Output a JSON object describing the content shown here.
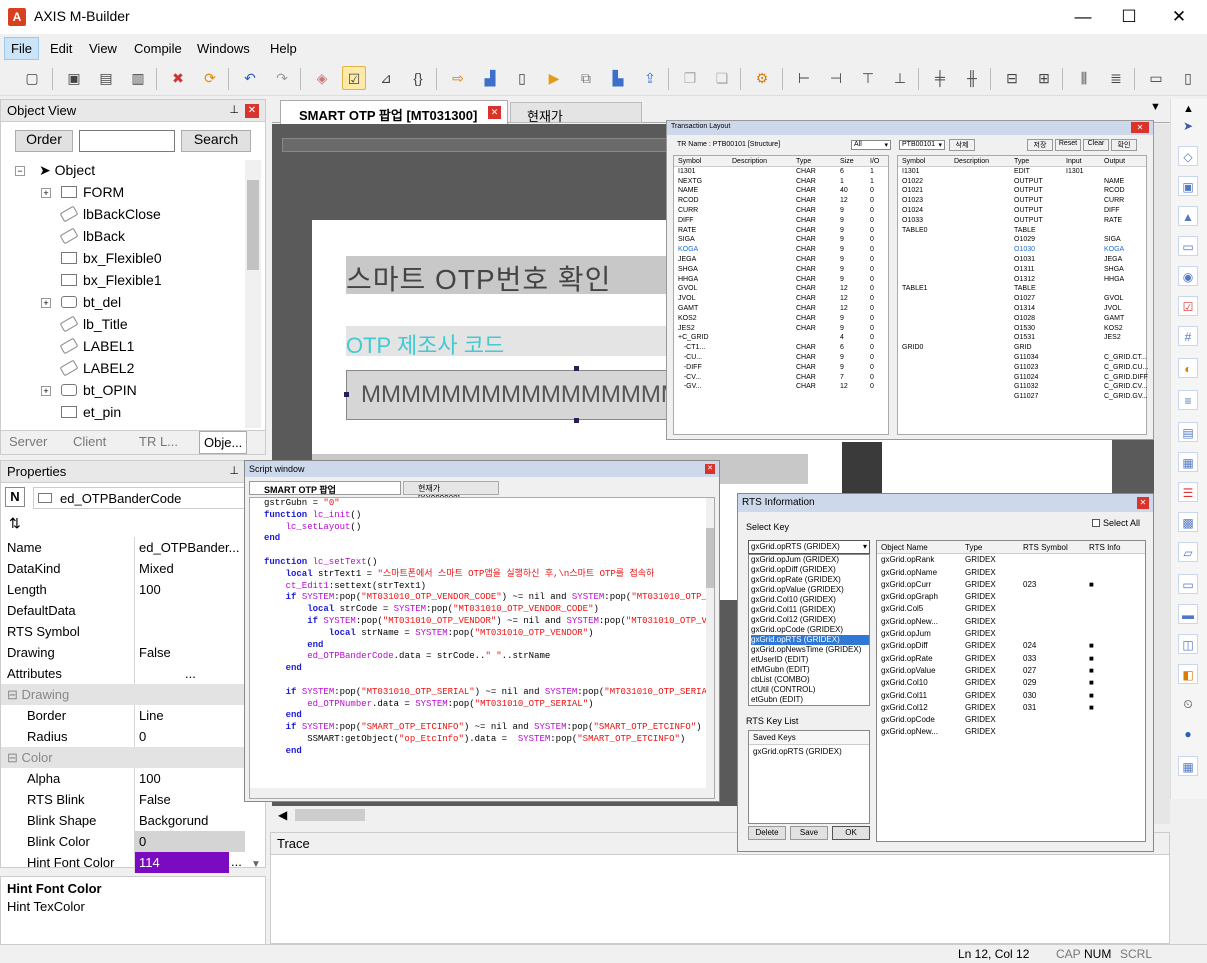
{
  "app": {
    "title": "AXIS M-Builder",
    "logo": "A",
    "min": "—",
    "max": "☐",
    "close": "✕"
  },
  "menu": [
    "File",
    "Edit",
    "View",
    "Compile",
    "Windows",
    "Help"
  ],
  "objectView": {
    "title": "Object View",
    "order": "Order",
    "search": "Search",
    "tree": [
      "Object",
      "FORM",
      "lbBackClose",
      "lbBack",
      "bx_Flexible0",
      "bx_Flexible1",
      "bt_del",
      "lb_Title",
      "LABEL1",
      "LABEL2",
      "bt_OPIN",
      "et_pin"
    ],
    "tabs": [
      "Server",
      "Client",
      "TR L...",
      "Obje..."
    ]
  },
  "properties": {
    "title": "Properties",
    "sortBtn": "N",
    "objectName": "ed_OTPBanderCode",
    "rows": [
      [
        "Name",
        "ed_OTPBander..."
      ],
      [
        "DataKind",
        "Mixed"
      ],
      [
        "Length",
        "100"
      ],
      [
        "DefaultData",
        ""
      ],
      [
        "RTS Symbol",
        ""
      ],
      [
        "Drawing",
        "False"
      ],
      [
        "Attributes",
        "..."
      ]
    ],
    "drawingCat": "Drawing",
    "drawingRows": [
      [
        "Border",
        "Line"
      ],
      [
        "Radius",
        "0"
      ]
    ],
    "colorCat": "Color",
    "colorRows": [
      [
        "Alpha",
        "100"
      ],
      [
        "RTS Blink",
        "False"
      ],
      [
        "Blink Shape",
        "Backgorund"
      ],
      [
        "Blink Color",
        "0"
      ],
      [
        "Hint Font Color",
        "114"
      ]
    ],
    "descTitle": "Hint Font Color",
    "descText": "Hint TexColor"
  },
  "docTabs": [
    "SMART OTP 팝업 [MT031300]",
    "현재가 [XX999900]"
  ],
  "canvas": {
    "title": "스마트 OTP번호 확인",
    "label": "OTP 제조사 코드",
    "field": "MMMMMMMMMMMMMMMMM"
  },
  "trLayout": {
    "title": "Transaction Layout",
    "trName": "TR Name :",
    "trCode": "PTB00101",
    "structure": "[Structure]",
    "all": "All",
    "combo2": "PTB00101",
    "del": "삭제",
    "save": "저장",
    "reset": "Reset",
    "clear": "Clear",
    "ok": "확인",
    "leftHdr": [
      "Symbol",
      "Description",
      "Type",
      "Size",
      "I/O"
    ],
    "left": [
      [
        "I1301",
        "",
        "CHAR",
        "6",
        "1"
      ],
      [
        "NEXTG",
        "",
        "CHAR",
        "1",
        "1"
      ],
      [
        "NAME",
        "",
        "CHAR",
        "40",
        "0"
      ],
      [
        "RCOD",
        "",
        "CHAR",
        "12",
        "0"
      ],
      [
        "CURR",
        "",
        "CHAR",
        "9",
        "0"
      ],
      [
        "DIFF",
        "",
        "CHAR",
        "9",
        "0"
      ],
      [
        "RATE",
        "",
        "CHAR",
        "9",
        "0"
      ],
      [
        "SIGA",
        "",
        "CHAR",
        "9",
        "0"
      ],
      [
        "KOGA",
        "",
        "CHAR",
        "9",
        "0"
      ],
      [
        "JEGA",
        "",
        "CHAR",
        "9",
        "0"
      ],
      [
        "SHGA",
        "",
        "CHAR",
        "9",
        "0"
      ],
      [
        "HHGA",
        "",
        "CHAR",
        "9",
        "0"
      ],
      [
        "GVOL",
        "",
        "CHAR",
        "12",
        "0"
      ],
      [
        "JVOL",
        "",
        "CHAR",
        "12",
        "0"
      ],
      [
        "GAMT",
        "",
        "CHAR",
        "12",
        "0"
      ],
      [
        "KOS2",
        "",
        "CHAR",
        "9",
        "0"
      ],
      [
        "JES2",
        "",
        "CHAR",
        "9",
        "0"
      ],
      [
        "+C_GRID",
        "",
        "",
        "4",
        "0"
      ],
      [
        "   -CT1...",
        "",
        "CHAR",
        "6",
        "0"
      ],
      [
        "   -CU...",
        "",
        "CHAR",
        "9",
        "0"
      ],
      [
        "   -DIFF",
        "",
        "CHAR",
        "9",
        "0"
      ],
      [
        "   -CV...",
        "",
        "CHAR",
        "7",
        "0"
      ],
      [
        "   -GV...",
        "",
        "CHAR",
        "12",
        "0"
      ]
    ],
    "rightHdr": [
      "Symbol",
      "Description",
      "Type",
      "Input",
      "Output"
    ],
    "right": [
      [
        "I1301",
        "",
        "EDIT",
        "I1301",
        ""
      ],
      [
        "O1022",
        "",
        "OUTPUT",
        "",
        "NAME"
      ],
      [
        "O1021",
        "",
        "OUTPUT",
        "",
        "RCOD"
      ],
      [
        "O1023",
        "",
        "OUTPUT",
        "",
        "CURR"
      ],
      [
        "O1024",
        "",
        "OUTPUT",
        "",
        "DIFF"
      ],
      [
        "O1033",
        "",
        "OUTPUT",
        "",
        "RATE"
      ],
      [
        "TABLE0",
        "",
        "TABLE",
        "",
        ""
      ],
      [
        "",
        "",
        "O1029",
        "",
        "SIGA"
      ],
      [
        "",
        "",
        "O1030",
        "",
        "KOGA"
      ],
      [
        "",
        "",
        "O1031",
        "",
        "JEGA"
      ],
      [
        "",
        "",
        "O1311",
        "",
        "SHGA"
      ],
      [
        "",
        "",
        "O1312",
        "",
        "HHGA"
      ],
      [
        "TABLE1",
        "",
        "TABLE",
        "",
        ""
      ],
      [
        "",
        "",
        "O1027",
        "",
        "GVOL"
      ],
      [
        "",
        "",
        "O1314",
        "",
        "JVOL"
      ],
      [
        "",
        "",
        "O1028",
        "",
        "GAMT"
      ],
      [
        "",
        "",
        "O1530",
        "",
        "KOS2"
      ],
      [
        "",
        "",
        "O1531",
        "",
        "JES2"
      ],
      [
        "GRID0",
        "",
        "GRID",
        "",
        ""
      ],
      [
        "",
        "",
        "G11034",
        "",
        "C_GRID.CT..."
      ],
      [
        "",
        "",
        "G11023",
        "",
        "C_GRID.CU..."
      ],
      [
        "",
        "",
        "G11024",
        "",
        "C_GRID.DIFF"
      ],
      [
        "",
        "",
        "G11032",
        "",
        "C_GRID.CV..."
      ],
      [
        "",
        "",
        "G11027",
        "",
        "C_GRID.GV..."
      ]
    ]
  },
  "script": {
    "title": "Script window",
    "tabs": [
      "SMART OTP 팝업 [MT031300]",
      "현재가 [XX999900]"
    ],
    "lines": [
      [
        [
          "gstrGubn = ",
          ""
        ],
        [
          "\"0\"",
          "str"
        ]
      ],
      [
        [
          "function ",
          "kw"
        ],
        [
          "lc_init",
          "fn"
        ],
        [
          "()",
          ""
        ]
      ],
      [
        [
          "    ",
          ""
        ],
        [
          "lc_setLayout",
          "fn"
        ],
        [
          "()",
          ""
        ]
      ],
      [
        [
          "end",
          "kw"
        ]
      ],
      [
        [
          "",
          ""
        ]
      ],
      [
        [
          "function ",
          "kw"
        ],
        [
          "lc_setText",
          "fn"
        ],
        [
          "()",
          ""
        ]
      ],
      [
        [
          "    local ",
          "kw"
        ],
        [
          "strText1 = ",
          ""
        ],
        [
          "\"스마트폰에서 스마트 OTP앱을 실행하신 후,\\n스마트 OTP를 접속하",
          ""
        ]
      ],
      [
        [
          "    ",
          ""
        ],
        [
          "ct_Edit1",
          "fn"
        ],
        [
          ":settext(strText1)",
          ""
        ]
      ],
      [
        [
          "    if ",
          "kw"
        ],
        [
          "SYSTEM",
          "fn"
        ],
        [
          ":pop(",
          ""
        ],
        [
          "\"MT031010_OTP_VENDOR_CODE\"",
          "str"
        ],
        [
          ") ~= nil and ",
          ""
        ],
        [
          "SYSTEM",
          "fn"
        ],
        [
          ":pop(",
          ""
        ],
        [
          "\"MT031010_OTP_",
          "str"
        ]
      ],
      [
        [
          "        local ",
          "kw"
        ],
        [
          "strCode = ",
          ""
        ],
        [
          "SYSTEM",
          "fn"
        ],
        [
          ":pop(",
          ""
        ],
        [
          "\"MT031010_OTP_VENDOR_CODE\"",
          "str"
        ],
        [
          ")",
          ""
        ]
      ],
      [
        [
          "        if ",
          "kw"
        ],
        [
          "SYSTEM",
          "fn"
        ],
        [
          ":pop(",
          ""
        ],
        [
          "\"MT031010_OTP_VENDOR\"",
          "str"
        ],
        [
          ") ~= nil and ",
          ""
        ],
        [
          "SYSTEM",
          "fn"
        ],
        [
          ":pop(",
          ""
        ],
        [
          "\"MT031010_OTP_V",
          "str"
        ]
      ],
      [
        [
          "            local ",
          "kw"
        ],
        [
          "strName = ",
          ""
        ],
        [
          "SYSTEM",
          "fn"
        ],
        [
          ":pop(",
          ""
        ],
        [
          "\"MT031010_OTP_VENDOR\"",
          "str"
        ],
        [
          ")",
          ""
        ]
      ],
      [
        [
          "        end",
          "kw"
        ]
      ],
      [
        [
          "        ",
          ""
        ],
        [
          "ed_OTPBanderCode",
          "fn"
        ],
        [
          ".data = strCode..",
          ""
        ],
        [
          "\" \"",
          "str"
        ],
        [
          "..strName",
          ""
        ]
      ],
      [
        [
          "    end",
          "kw"
        ]
      ],
      [
        [
          "",
          ""
        ]
      ],
      [
        [
          "    if ",
          "kw"
        ],
        [
          "SYSTEM",
          "fn"
        ],
        [
          ":pop(",
          ""
        ],
        [
          "\"MT031010_OTP_SERIAL\"",
          "str"
        ],
        [
          ") ~= nil and ",
          ""
        ],
        [
          "SYSTEM",
          "fn"
        ],
        [
          ":pop(",
          ""
        ],
        [
          "\"MT031010_OTP_SERIA",
          "str"
        ]
      ],
      [
        [
          "        ",
          ""
        ],
        [
          "ed_OTPNumber",
          "fn"
        ],
        [
          ".data = ",
          ""
        ],
        [
          "SYSTEM",
          "fn"
        ],
        [
          ":pop(",
          ""
        ],
        [
          "\"MT031010_OTP_SERIAL\"",
          "str"
        ],
        [
          ")",
          ""
        ]
      ],
      [
        [
          "    end",
          "kw"
        ]
      ],
      [
        [
          "    if ",
          "kw"
        ],
        [
          "SYSTEM",
          "fn"
        ],
        [
          ":pop(",
          ""
        ],
        [
          "\"SMART_OTP_ETCINFO\"",
          "str"
        ],
        [
          ") ~= nil and ",
          ""
        ],
        [
          "SYSTEM",
          "fn"
        ],
        [
          ":pop(",
          ""
        ],
        [
          "\"SMART_OTP_ETCINFO\"",
          "str"
        ],
        [
          ")",
          ""
        ]
      ],
      [
        [
          "        SSMART:getObject(",
          ""
        ],
        [
          "\"op_EtcInfo\"",
          "str"
        ],
        [
          ").data =  ",
          ""
        ],
        [
          "SYSTEM",
          "fn"
        ],
        [
          ":pop(",
          ""
        ],
        [
          "\"SMART_OTP_ETCINFO\"",
          "str"
        ],
        [
          ")",
          ""
        ]
      ],
      [
        [
          "    end",
          "kw"
        ]
      ]
    ]
  },
  "rts": {
    "title": "RTS Information",
    "selectKey": "Select Key",
    "selectAll": "Select All",
    "combo": "gxGrid.opRTS (GRIDEX)",
    "keys": [
      "gxGrid.opJum (GRIDEX)",
      "gxGrid.opDiff (GRIDEX)",
      "gxGrid.opRate (GRIDEX)",
      "gxGrid.opValue (GRIDEX)",
      "gxGrid.Col10 (GRIDEX)",
      "gxGrid.Col11 (GRIDEX)",
      "gxGrid.Col12 (GRIDEX)",
      "gxGrid.opCode (GRIDEX)",
      "gxGrid.opRTS (GRIDEX)",
      "gxGrid.opNewsTime (GRIDEX)",
      "etUserID (EDIT)",
      "etMGubn (EDIT)",
      "cbList (COMBO)",
      "ctUtil (CONTROL)",
      "etGubn (EDIT)"
    ],
    "keyList": "RTS Key List",
    "savedKeys": "Saved Keys",
    "saved": [
      "gxGrid.opRTS (GRIDEX)"
    ],
    "delete": "Delete",
    "save": "Save",
    "ok": "OK",
    "hdr": [
      "Object Name",
      "Type",
      "RTS Symbol",
      "RTS Info"
    ],
    "rows": [
      [
        "gxGrid.opRank",
        "GRIDEX",
        "",
        ""
      ],
      [
        "gxGrid.opName",
        "GRIDEX",
        "",
        ""
      ],
      [
        "gxGrid.opCurr",
        "GRIDEX",
        "023",
        "■"
      ],
      [
        "gxGrid.opGraph",
        "GRIDEX",
        "",
        ""
      ],
      [
        "gxGrid.Col5",
        "GRIDEX",
        "",
        ""
      ],
      [
        "gxGrid.opNew...",
        "GRIDEX",
        "",
        ""
      ],
      [
        "gxGrid.opJum",
        "GRIDEX",
        "",
        ""
      ],
      [
        "gxGrid.opDiff",
        "GRIDEX",
        "024",
        "■"
      ],
      [
        "gxGrid.opRate",
        "GRIDEX",
        "033",
        "■"
      ],
      [
        "gxGrid.opValue",
        "GRIDEX",
        "027",
        "■"
      ],
      [
        "gxGrid.Col10",
        "GRIDEX",
        "029",
        "■"
      ],
      [
        "gxGrid.Col11",
        "GRIDEX",
        "030",
        "■"
      ],
      [
        "gxGrid.Col12",
        "GRIDEX",
        "031",
        "■"
      ],
      [
        "gxGrid.opCode",
        "GRIDEX",
        "",
        ""
      ],
      [
        "gxGrid.opNew...",
        "GRIDEX",
        "",
        ""
      ]
    ]
  },
  "trace": {
    "title": "Trace"
  },
  "status": {
    "pos": "Ln 12, Col 12",
    "cap": "CAP",
    "num": "NUM",
    "scrl": "SCRL"
  }
}
